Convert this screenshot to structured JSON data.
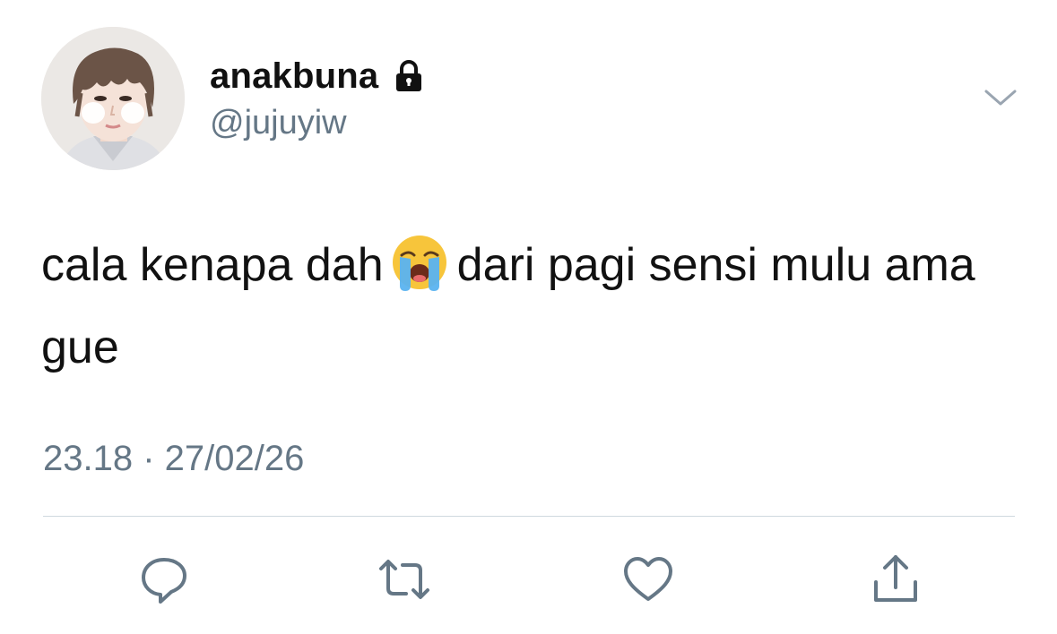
{
  "user": {
    "display_name": "anakbuna",
    "handle": "@jujuyiw",
    "protected_icon": "lock-icon",
    "avatar": "profile-photo"
  },
  "tweet": {
    "text_part1": "cala kenapa dah",
    "emoji": "loudly-crying-face",
    "text_part2": "dari pagi sensi mulu ama gue",
    "timestamp": "23.18 · 27/02/26"
  },
  "actions": [
    {
      "name": "reply",
      "icon": "speech-bubble-icon"
    },
    {
      "name": "retweet",
      "icon": "retweet-arrows-icon"
    },
    {
      "name": "like",
      "icon": "heart-icon"
    },
    {
      "name": "share",
      "icon": "share-upload-icon"
    }
  ],
  "colors": {
    "text": "#111111",
    "secondary": "#657786",
    "divider": "#cfd9de",
    "emoji_face": "#f7c53b",
    "tears": "#5ab3f0"
  }
}
